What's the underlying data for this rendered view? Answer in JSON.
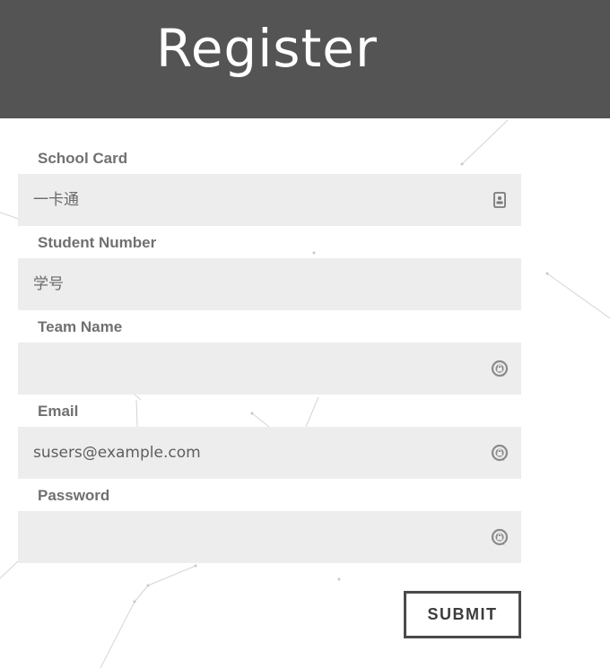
{
  "header": {
    "title": "Register"
  },
  "form": {
    "fields": [
      {
        "label": "School Card",
        "value": "",
        "placeholder": "一卡通",
        "icon": "id-card-icon"
      },
      {
        "label": "Student Number",
        "value": "",
        "placeholder": "学号",
        "icon": ""
      },
      {
        "label": "Team Name",
        "value": "",
        "placeholder": "",
        "icon": "lock-icon"
      },
      {
        "label": "Email",
        "value": "susers@example.com",
        "placeholder": "",
        "icon": "lock-icon"
      },
      {
        "label": "Password",
        "value": "",
        "placeholder": "",
        "icon": "lock-icon"
      }
    ],
    "submit_label": "SUBMIT"
  },
  "colors": {
    "header_bg": "#545454",
    "field_bg": "#ededed",
    "label_text": "#707070",
    "button_border": "#4a4a4a"
  }
}
